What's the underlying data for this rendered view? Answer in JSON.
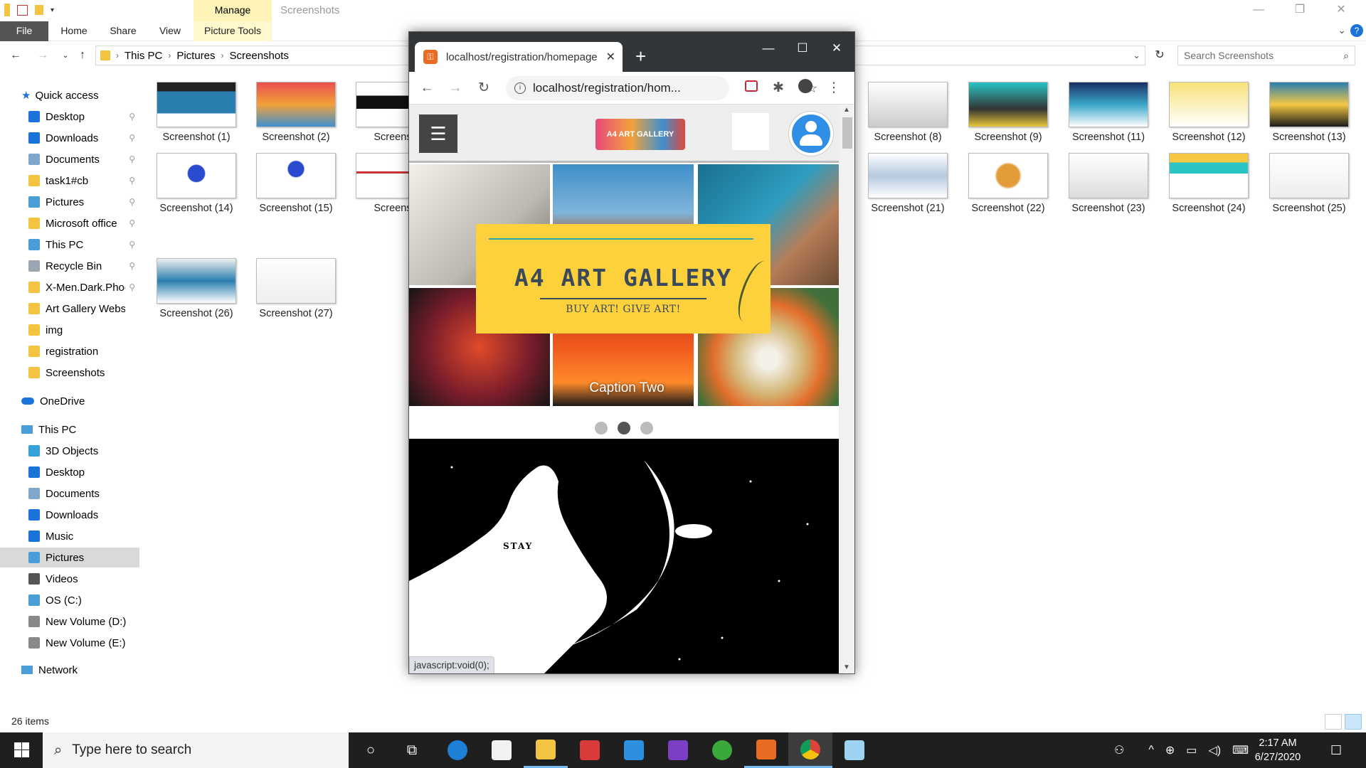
{
  "explorer": {
    "title": "Screenshots",
    "manage_tab": "Manage",
    "ribbon": {
      "file": "File",
      "home": "Home",
      "share": "Share",
      "view": "View",
      "picture_tools": "Picture Tools"
    },
    "breadcrumb": [
      "This PC",
      "Pictures",
      "Screenshots"
    ],
    "search_placeholder": "Search Screenshots",
    "nav": {
      "quick_access": "Quick access",
      "quick_items": [
        "Desktop",
        "Downloads",
        "Documents",
        "task1#cb",
        "Pictures",
        "Microsoft office",
        "This PC",
        "Recycle Bin",
        "X-Men.Dark.Phoe",
        "Art Gallery Website",
        "img",
        "registration",
        "Screenshots"
      ],
      "onedrive": "OneDrive",
      "this_pc": "This PC",
      "pc_items": [
        "3D Objects",
        "Desktop",
        "Documents",
        "Downloads",
        "Music",
        "Pictures",
        "Videos",
        "OS (C:)",
        "New Volume (D:)",
        "New Volume (E:)"
      ],
      "network": "Network"
    },
    "files_left": [
      "Screenshot (1)",
      "Screenshot (2)",
      "Screensh",
      "Screenshot (14)",
      "Screenshot (15)",
      "Screensh",
      "Screenshot (26)",
      "Screenshot (27)"
    ],
    "files_right": [
      "Screenshot (8)",
      "Screenshot (9)",
      "Screenshot (11)",
      "Screenshot (12)",
      "Screenshot (13)",
      "Screenshot (21)",
      "Screenshot (22)",
      "Screenshot (23)",
      "Screenshot (24)",
      "Screenshot (25)"
    ],
    "status": "26 items"
  },
  "chrome": {
    "tab_title": "localhost/registration/homepage",
    "url": "localhost/registration/hom...",
    "status_link": "javascript:void(0);",
    "site": {
      "logo_small": "A4 ART GALLERY",
      "banner_title": "A4 ART GALLERY",
      "banner_sub": "BUY ART! GIVE ART!",
      "caption": "Caption Two",
      "art_text": "STAY",
      "hamburger": "☰"
    }
  },
  "taskbar": {
    "search_placeholder": "Type here to search",
    "time": "2:17 AM",
    "date": "6/27/2020"
  },
  "colors": {
    "accent": "#0078d7",
    "banner": "#fcd13c",
    "chrome_dark": "#323639",
    "taskbar": "#1f1f1f"
  }
}
